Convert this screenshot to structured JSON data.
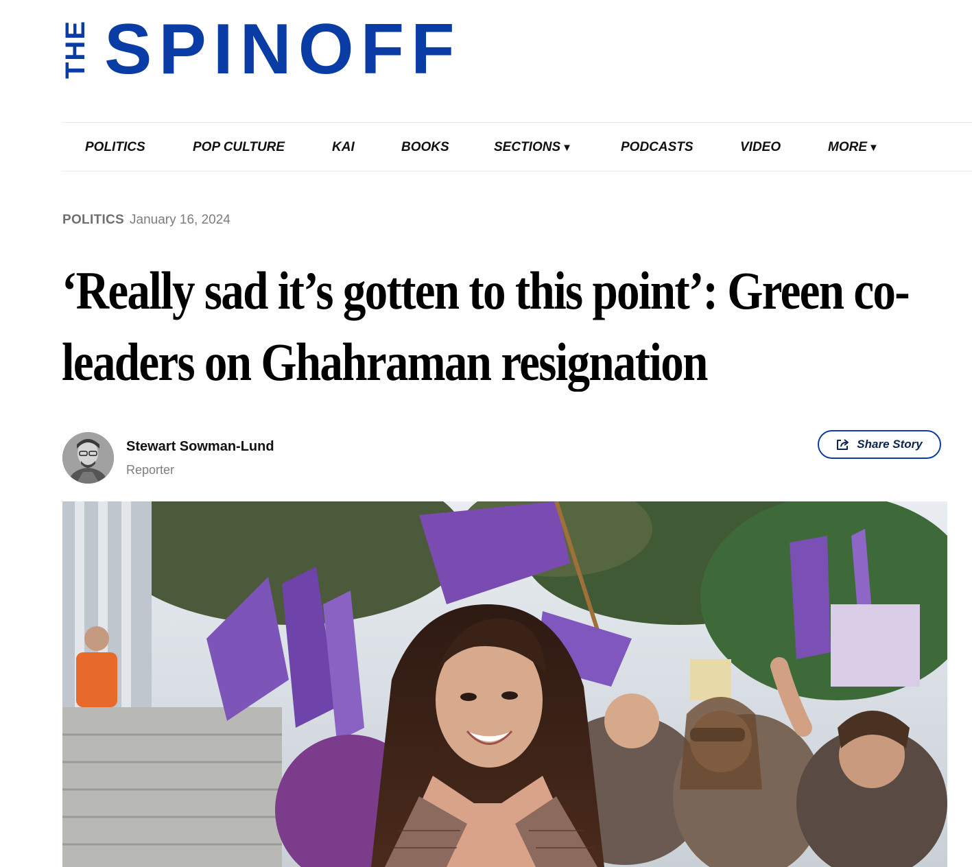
{
  "site": {
    "logo_the": "THE",
    "logo_main": "SPINOFF",
    "brand_color": "#0a3ca5"
  },
  "nav": {
    "items": [
      {
        "label": "POLITICS",
        "has_dropdown": false
      },
      {
        "label": "POP CULTURE",
        "has_dropdown": false
      },
      {
        "label": "KAI",
        "has_dropdown": false
      },
      {
        "label": "BOOKS",
        "has_dropdown": false
      },
      {
        "label": "SECTIONS",
        "has_dropdown": true
      },
      {
        "label": "PODCASTS",
        "has_dropdown": false
      },
      {
        "label": "VIDEO",
        "has_dropdown": false
      },
      {
        "label": "MORE",
        "has_dropdown": true
      }
    ],
    "dropdown_glyph": "▼"
  },
  "article": {
    "section": "POLITICS",
    "date": "January 16, 2024",
    "headline_line1": "‘Really sad it’s gotten to this point’: Green co-",
    "headline_line2": "leaders on Ghahraman resignation",
    "author": {
      "name": "Stewart Sowman-Lund",
      "role": "Reporter"
    },
    "share_label": "Share Story",
    "share_icon": "share-arrow-icon",
    "hero_image_subject": "protest-crowd-photo"
  }
}
